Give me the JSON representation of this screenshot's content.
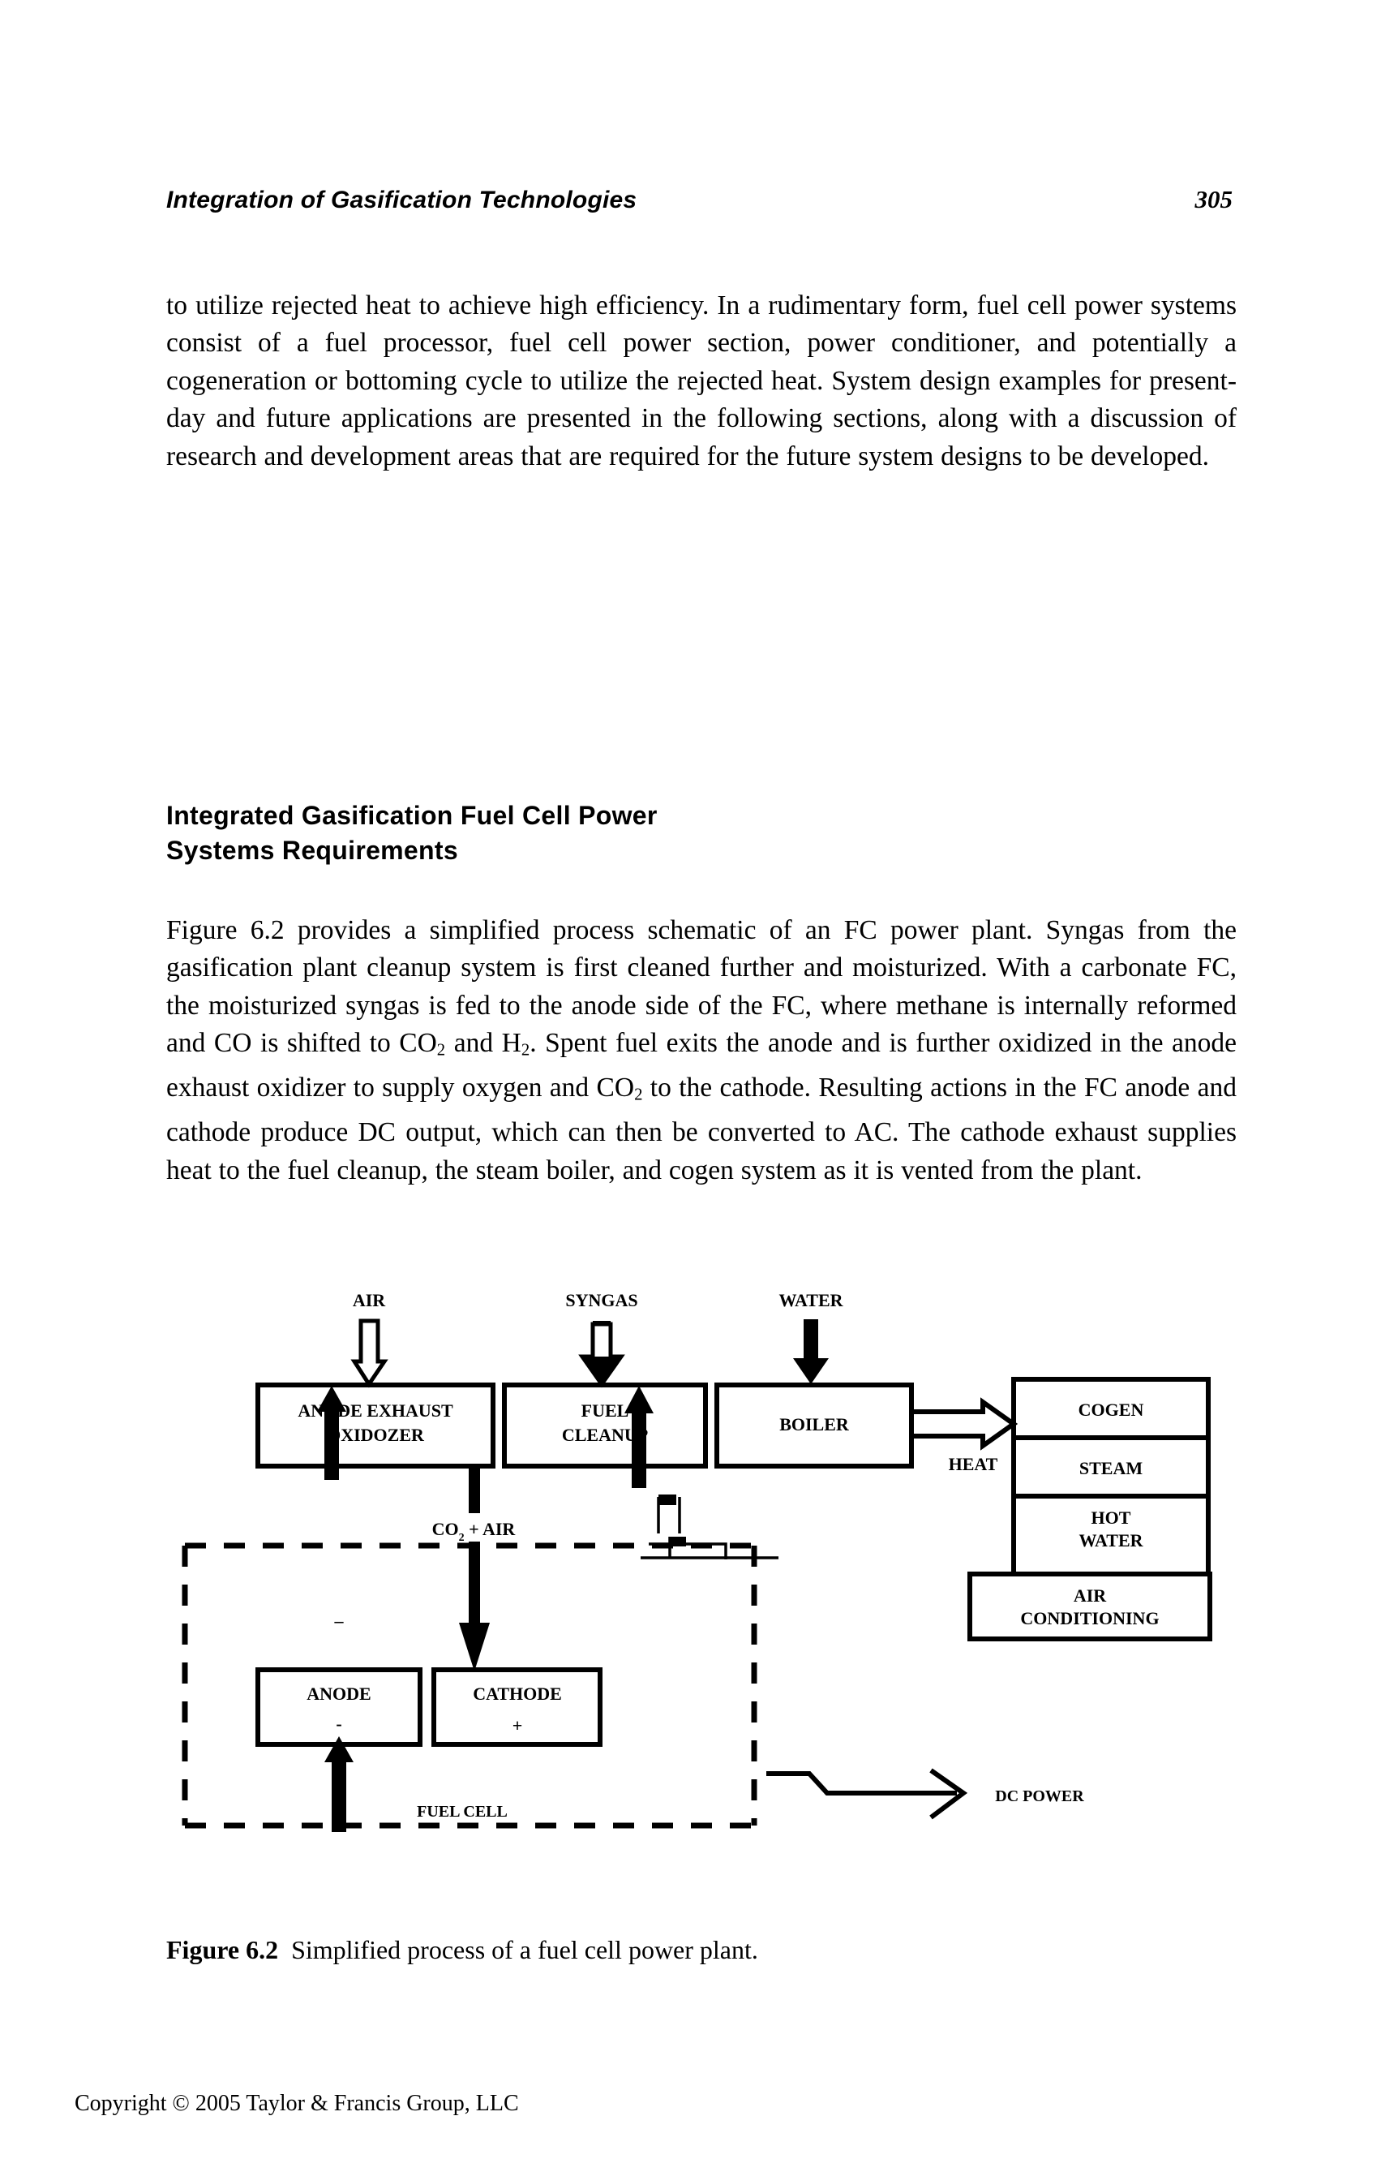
{
  "running_head": {
    "title": "Integration of Gasification Technologies",
    "page_number": "305"
  },
  "paragraphs": {
    "p1_part1": "to utilize rejected heat to achieve high efficiency. In a rudimentary form, fuel cell power systems consist of a fuel processor, fuel cell power section, power conditioner, and potentially a cogeneration or bottoming cycle to utilize the rejected heat. System design examples for present-day and future applications are presented in the following sections, along with a discussion of research and development areas that are required for the future system designs to be developed.",
    "p2_a": "Figure 6.2 provides a simplified process schematic of an FC power plant. Syngas from the gasification plant cleanup system is first cleaned further and moisturized. With a carbonate FC, the moisturized syngas is fed to the anode side of the FC, where methane is internally reformed and CO is shifted to CO",
    "p2_sub1": "2",
    "p2_b": " and H",
    "p2_sub2": "2",
    "p2_c": ". Spent fuel exits the anode and is further oxidized in the anode exhaust oxidizer to supply oxygen and CO",
    "p2_sub3": "2",
    "p2_d": " to the cathode. Resulting actions in the FC anode and cathode produce DC output, which can then be converted to AC. The cathode exhaust supplies heat to the fuel cleanup, the steam boiler, and cogen system as it is vented from the plant."
  },
  "section_heading": {
    "line1": "Integrated Gasification Fuel Cell Power",
    "line2": "Systems Requirements"
  },
  "figure": {
    "inputs": {
      "air": "AIR",
      "syngas": "SYNGAS",
      "water": "WATER"
    },
    "boxes": {
      "anode_exhaust_oxidozer_line1": "ANODE EXHAUST",
      "anode_exhaust_oxidozer_line2": "OXIDOZER",
      "fuel_cleanup_line1": "FUEL",
      "fuel_cleanup_line2": "CLEANUP",
      "boiler": "BOILER",
      "cogen": "COGEN",
      "steam": "STEAM",
      "hot_water_line1": "HOT",
      "hot_water_line2": "WATER",
      "air_conditioning_line1": "AIR",
      "air_conditioning_line2": "CONDITIONING",
      "anode": "ANODE",
      "anode_sign": "-",
      "cathode": "CATHODE",
      "cathode_sign": "+"
    },
    "labels": {
      "heat": "HEAT",
      "co2_air_pre": "CO",
      "co2_air_sub": "2",
      "co2_air_post": " + AIR",
      "fuel_cell": "FUEL CELL",
      "dc_power": "DC POWER"
    },
    "colors": {
      "line": "#000000",
      "background": "#ffffff"
    }
  },
  "caption": {
    "label": "Figure 6.2",
    "text": "Simplified process of a fuel cell power plant."
  },
  "footer": {
    "copyright": "Copyright © 2005 Taylor & Francis Group, LLC"
  }
}
